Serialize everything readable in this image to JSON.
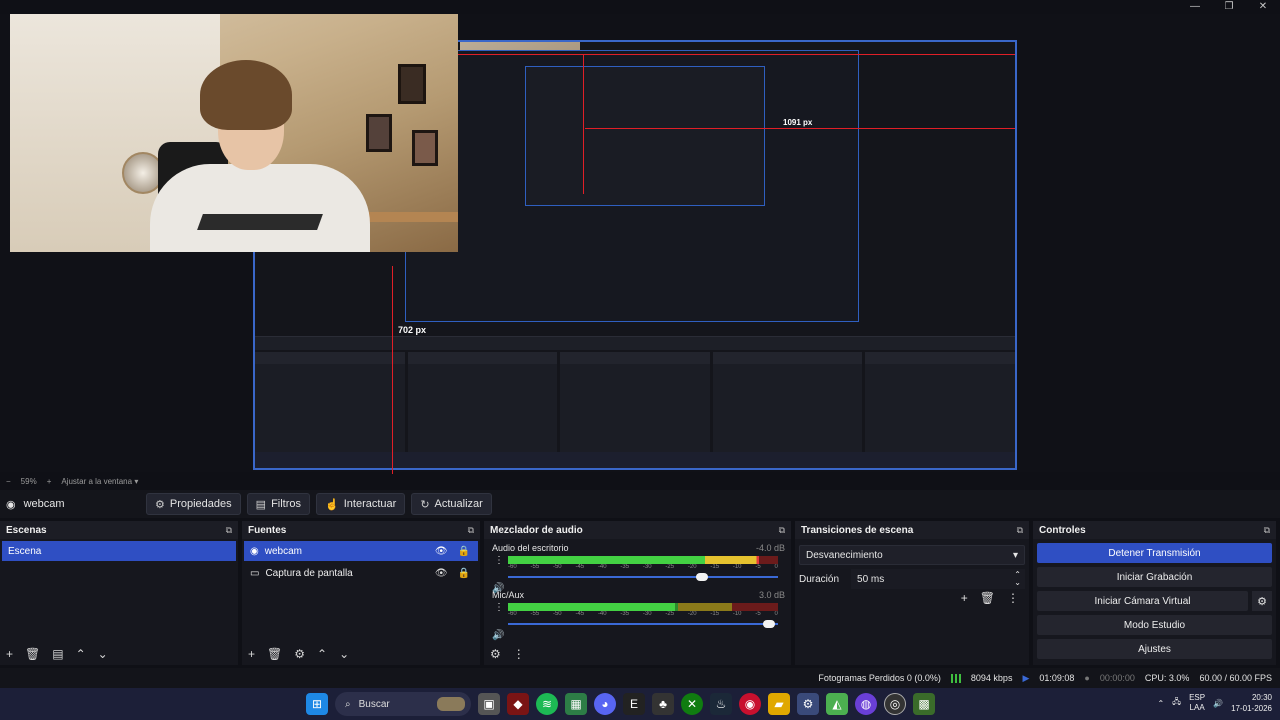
{
  "window": {
    "controls": [
      "—",
      "❐",
      "✕"
    ]
  },
  "preview": {
    "measure_1": "1091 px",
    "measure_2": "702 px"
  },
  "zoom": {
    "minus": "−",
    "value": "59%",
    "plus": "+",
    "fit": "Ajustar a la ventana"
  },
  "source_toolbar": {
    "source_name": "webcam",
    "properties": "Propiedades",
    "filters": "Filtros",
    "interact": "Interactuar",
    "refresh": "Actualizar"
  },
  "scenes": {
    "title": "Escenas",
    "items": [
      "Escena"
    ]
  },
  "sources": {
    "title": "Fuentes",
    "items": [
      "webcam",
      "Captura de pantalla"
    ]
  },
  "mixer": {
    "title": "Mezclador de audio",
    "ticks": [
      "-60",
      "-55",
      "-50",
      "-45",
      "-40",
      "-35",
      "-30",
      "-25",
      "-20",
      "-15",
      "-10",
      "-5",
      "0"
    ],
    "channels": [
      {
        "name": "Audio del escritorio",
        "db": "-4.0 dB",
        "level": 0.93,
        "volume": 0.74
      },
      {
        "name": "Mic/Aux",
        "db": "3.0 dB",
        "level": 0.62,
        "volume": 0.99
      }
    ]
  },
  "transitions": {
    "title": "Transiciones de escena",
    "selected": "Desvanecimiento",
    "duration_label": "Duración",
    "duration_value": "50 ms"
  },
  "controls": {
    "title": "Controles",
    "stop_stream": "Detener Transmisión",
    "start_record": "Iniciar Grabación",
    "start_vcam": "Iniciar Cámara Virtual",
    "studio_mode": "Modo Estudio",
    "settings": "Ajustes"
  },
  "status": {
    "dropped": "Fotogramas Perdidos 0 (0.0%)",
    "bitrate": "8094 kbps",
    "stream_time": "01:09:08",
    "record_time": "00:00:00",
    "cpu": "CPU: 3.0%",
    "fps": "60.00 / 60.00 FPS"
  },
  "taskbar": {
    "search": "Buscar",
    "lang_1": "ESP",
    "lang_2": "LAA",
    "time": "20:30",
    "date": "17-01-2026"
  },
  "colors": {
    "accent": "#2f4fc3",
    "guide": "#e01f27",
    "taskbar": "#1c1f38"
  }
}
